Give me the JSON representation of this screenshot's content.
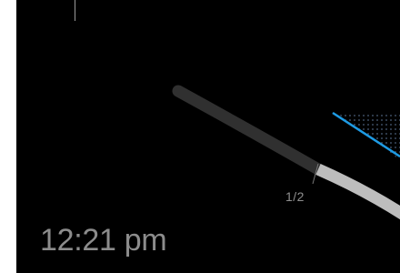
{
  "status": {
    "clock_text": "12:21 pm"
  },
  "pager": {
    "page_indicator": "1/2",
    "current_page": 1,
    "total_pages": 2
  },
  "colors": {
    "background": "#000000",
    "track_inactive": "#303030",
    "track_active": "#bdbdbd",
    "accent": "#1e9be4",
    "dots": "#3a4a5e",
    "text": "#8c8c8c"
  }
}
